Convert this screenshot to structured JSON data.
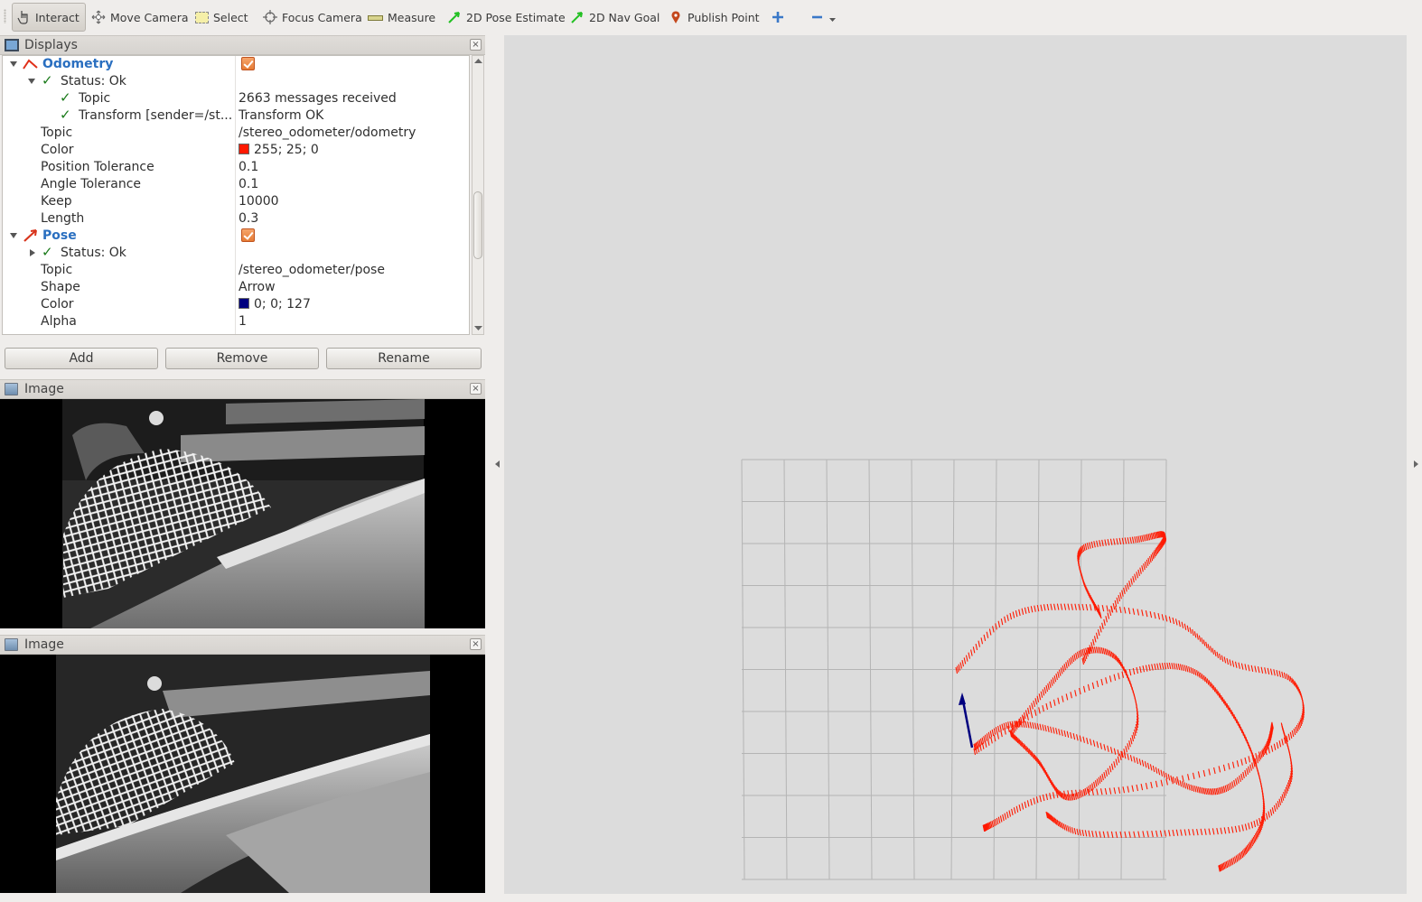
{
  "toolbar": {
    "tools": [
      {
        "label": "Interact",
        "icon": "hand-pointer-icon"
      },
      {
        "label": "Move Camera",
        "icon": "move-camera-icon"
      },
      {
        "label": "Select",
        "icon": "select-box-icon"
      },
      {
        "label": "Focus Camera",
        "icon": "focus-camera-icon"
      },
      {
        "label": "Measure",
        "icon": "ruler-icon"
      },
      {
        "label": "2D Pose Estimate",
        "icon": "green-arrow-icon"
      },
      {
        "label": "2D Nav Goal",
        "icon": "green-arrow-icon"
      },
      {
        "label": "Publish Point",
        "icon": "map-pin-icon"
      }
    ],
    "add_tool_icon": "plus-icon",
    "remove_tool_icon": "minus-icon"
  },
  "displays_panel": {
    "title": "Displays",
    "tree": {
      "odometry": {
        "name": "Odometry",
        "status": "Status: Ok",
        "topic_status_label": "Topic",
        "topic_status_value": "2663 messages received",
        "transform_label": "Transform [sender=/st...",
        "transform_value": "Transform OK",
        "topic_label": "Topic",
        "topic_value": "/stereo_odometer/odometry",
        "color_label": "Color",
        "color_value": "255; 25; 0",
        "color_hex": "#ff1900",
        "pos_tol_label": "Position Tolerance",
        "pos_tol_value": "0.1",
        "ang_tol_label": "Angle Tolerance",
        "ang_tol_value": "0.1",
        "keep_label": "Keep",
        "keep_value": "10000",
        "length_label": "Length",
        "length_value": "0.3"
      },
      "pose": {
        "name": "Pose",
        "status": "Status: Ok",
        "topic_label": "Topic",
        "topic_value": "/stereo_odometer/pose",
        "shape_label": "Shape",
        "shape_value": "Arrow",
        "color_label": "Color",
        "color_value": "0; 0; 127",
        "color_hex": "#00007f",
        "alpha_label": "Alpha",
        "alpha_value": "1"
      }
    },
    "buttons": {
      "add": "Add",
      "remove": "Remove",
      "rename": "Rename"
    }
  },
  "image_panels": [
    {
      "title": "Image"
    },
    {
      "title": "Image"
    }
  ],
  "colors": {
    "accent_blue": "#2a6fc0",
    "odometry_red": "#ff1900",
    "pose_blue": "#00007f",
    "check_green": "#1a7a1a"
  }
}
